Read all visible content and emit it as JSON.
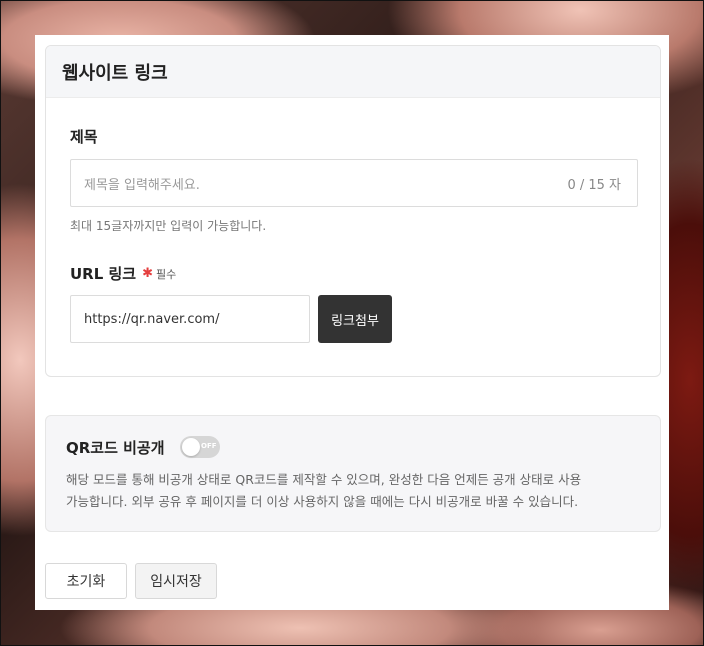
{
  "section": {
    "title": "웹사이트 링크"
  },
  "title_field": {
    "label": "제목",
    "placeholder": "제목을 입력해주세요.",
    "counter": "0 / 15 자",
    "hint": "최대 15글자까지만 입력이 가능합니다."
  },
  "url_field": {
    "label": "URL 링크",
    "required_mark": "✱",
    "required_text": "필수",
    "value": "https://qr.naver.com/",
    "attach_label": "링크첨부"
  },
  "qr_private": {
    "title": "QR코드 비공개",
    "toggle_state": "OFF",
    "description_line1": "해당 모드를 통해 비공개 상태로 QR코드를 제작할 수 있으며, 완성한 다음 언제든 공개 상태로 사용",
    "description_line2": "가능합니다. 외부 공유 후 페이지를 더 이상 사용하지 않을 때에는 다시 비공개로 바꿀 수 있습니다."
  },
  "actions": {
    "reset_label": "초기화",
    "save_draft_label": "임시저장"
  },
  "colors": {
    "accent_dark": "#333333",
    "required": "#e43e3e"
  }
}
